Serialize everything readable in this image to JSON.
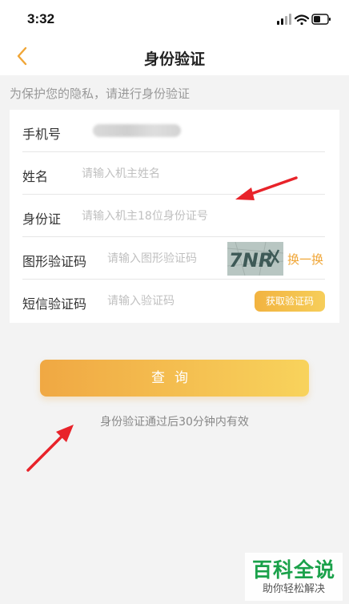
{
  "status_bar": {
    "time": "3:32",
    "icons": [
      "signal-icon",
      "wifi-icon",
      "battery-icon"
    ]
  },
  "nav": {
    "title": "身份验证",
    "back_icon": "chevron-left-icon"
  },
  "hint": "为保护您的隐私，请进行身份验证",
  "form": {
    "phone_label": "手机号",
    "name_label": "姓名",
    "name_placeholder": "请输入机主姓名",
    "id_label": "身份证",
    "id_placeholder": "请输入机主18位身份证号",
    "captcha_label": "图形验证码",
    "captcha_placeholder": "请输入图形验证码",
    "captcha_text": "7NR",
    "captcha_refresh": "换一换",
    "sms_label": "短信验证码",
    "sms_placeholder": "请输入验证码",
    "sms_button": "获取验证码"
  },
  "query_button": "查询",
  "valid_note": "身份验证通过后30分钟内有效",
  "watermark": {
    "main": "百科全说",
    "sub": "助你轻松解决"
  },
  "colors": {
    "accent": "#f0a637",
    "button_start": "#f0a843",
    "button_end": "#f8d35c",
    "arrow": "#e8232a",
    "watermark_green": "#1aa14a"
  }
}
